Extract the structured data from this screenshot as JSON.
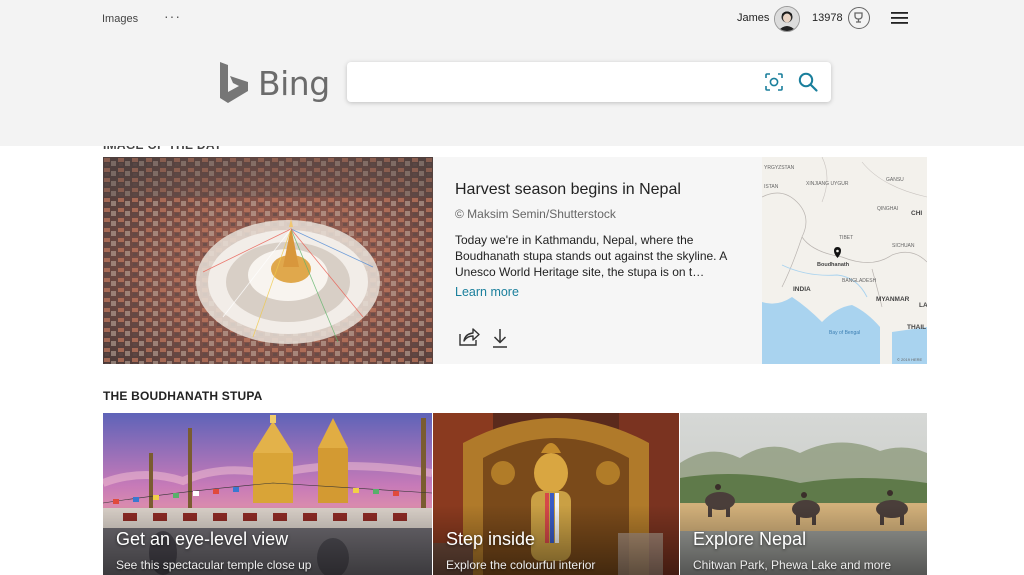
{
  "header": {
    "nav_images": "Images",
    "nav_more": "···",
    "user_name": "James",
    "rewards_count": "13978",
    "search": {
      "value": "",
      "placeholder": ""
    },
    "logo_text": "Bing",
    "brand_color": "#6b6b6b"
  },
  "iotd": {
    "heading_partial": "IMAGE OF THE DAY",
    "title": "Harvest season begins in Nepal",
    "copyright": "© Maksim Semin/Shutterstock",
    "description": "Today we're in Kathmandu, Nepal, where the Boudhanath stupa stands out against the skyline. A Unesco World Heritage site, the stupa is on t…",
    "learn_more": "Learn more",
    "link_color": "#1a7f9c",
    "map": {
      "labels": [
        "YRGYZSTAN",
        "ISTAN",
        "XINJIANG UYGUR",
        "GANSU",
        "QINGHAI",
        "CHI",
        "TIBET",
        "SICHUAN",
        "Boudhanath",
        "BANGLADESH",
        "INDIA",
        "MYANMAR",
        "LA",
        "THAIL",
        "Bay of Bengal",
        "© 2019 HERE"
      ]
    }
  },
  "stupa": {
    "heading": "THE BOUDHANATH STUPA",
    "tiles": [
      {
        "title": "Get an eye-level view",
        "subtitle": "See this spectacular temple close up"
      },
      {
        "title": "Step inside",
        "subtitle": "Explore the colourful interior"
      },
      {
        "title": "Explore Nepal",
        "subtitle": "Chitwan Park, Phewa Lake and more"
      }
    ]
  }
}
